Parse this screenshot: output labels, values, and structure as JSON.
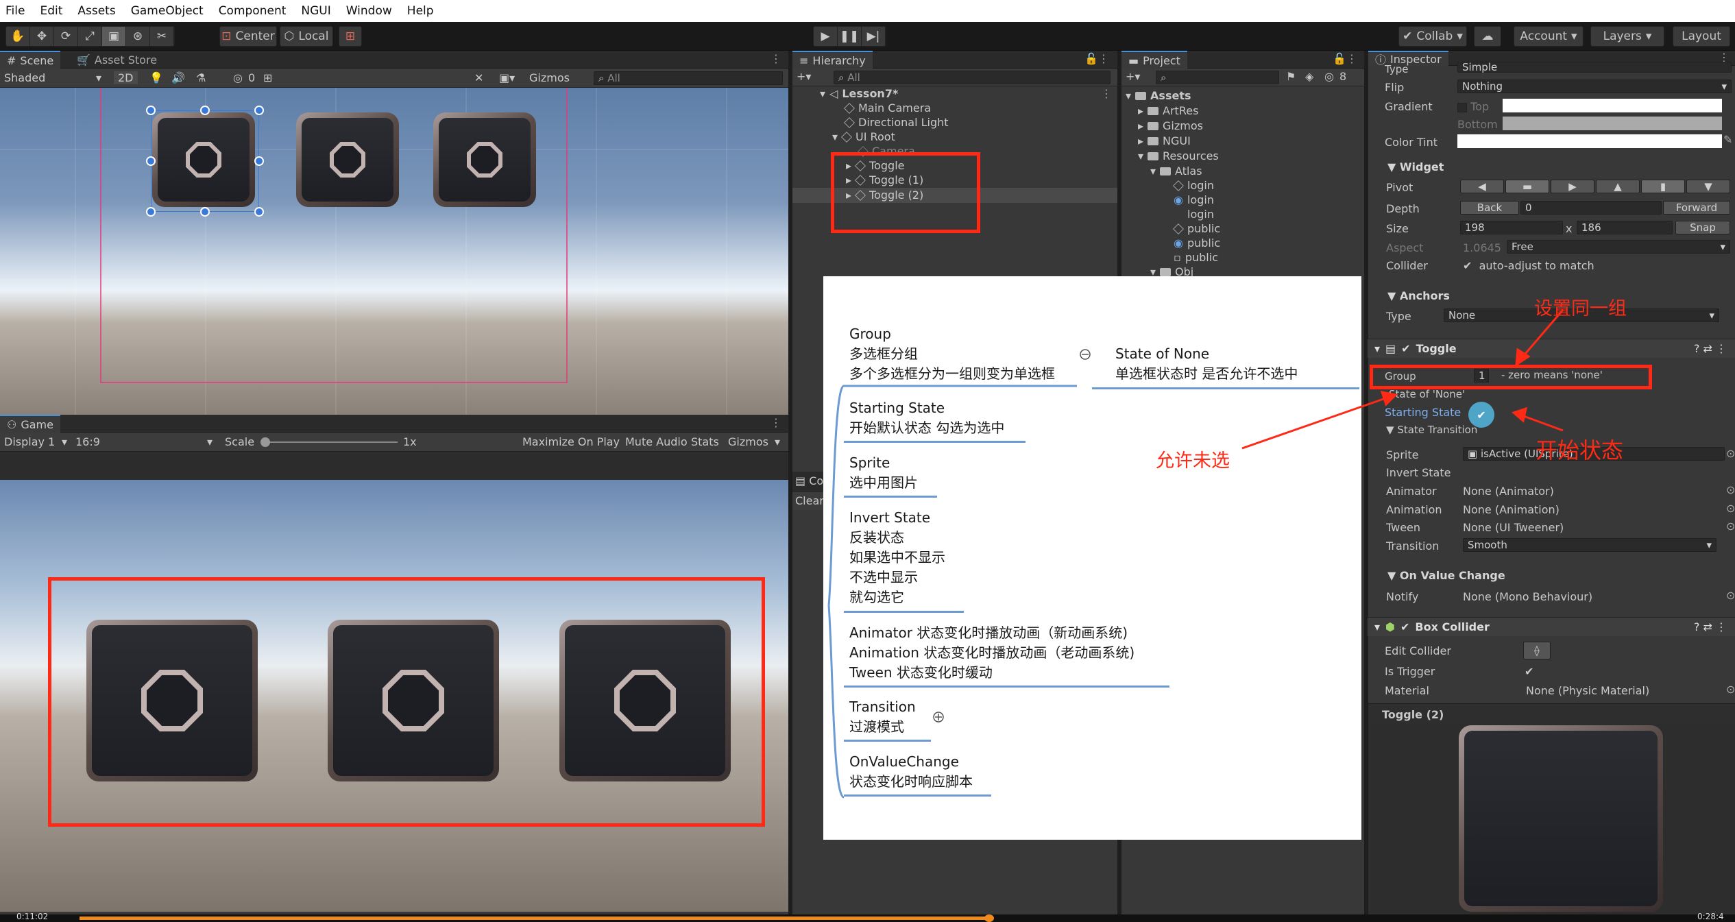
{
  "menu": [
    "File",
    "Edit",
    "Assets",
    "GameObject",
    "Component",
    "NGUI",
    "Window",
    "Help"
  ],
  "toolbar": {
    "center": "Center",
    "local": "Local",
    "collab": "Collab",
    "account": "Account",
    "layers": "Layers",
    "layout": "Layout"
  },
  "scene": {
    "tab": "Scene",
    "tab2": "Asset Store",
    "shading": "Shaded",
    "mode2d": "2D",
    "audio_count": "0",
    "gizmos": "Gizmos",
    "search_placeholder": "All"
  },
  "game": {
    "tab": "Game",
    "display": "Display 1",
    "aspect": "16:9",
    "scale_label": "Scale",
    "scale_value": "1x",
    "maximize": "Maximize On Play",
    "mute": "Mute Audio",
    "stats": "Stats",
    "gizmos": "Gizmos"
  },
  "hierarchy": {
    "tab": "Hierarchy",
    "search_placeholder": "All",
    "scene": "Lesson7*",
    "items": [
      "Main Camera",
      "Directional Light",
      "UI Root",
      "Camera",
      "Toggle",
      "Toggle (1)",
      "Toggle (2)"
    ]
  },
  "project": {
    "tab": "Project",
    "hidden_count": "8",
    "items": [
      "Assets",
      "ArtRes",
      "Gizmos",
      "NGUI",
      "Resources",
      "Atlas",
      "login",
      "login",
      "login",
      "public",
      "public",
      "public",
      "Obj"
    ]
  },
  "console": {
    "tab": "Co",
    "clear": "Clear"
  },
  "inspector": {
    "tab": "Inspector",
    "type_label": "Type",
    "type_value": "Simple",
    "flip_label": "Flip",
    "flip_value": "Nothing",
    "gradient_label": "Gradient",
    "top_label": "Top",
    "bottom_label": "Bottom",
    "tint_label": "Color Tint",
    "widget": "Widget",
    "pivot": "Pivot",
    "depth": "Depth",
    "back": "Back",
    "depth_value": "0",
    "forward": "Forward",
    "size": "Size",
    "size_w": "198",
    "size_x": "x",
    "size_h": "186",
    "snap": "Snap",
    "aspect": "Aspect",
    "aspect_value": "1.0645",
    "aspect_mode": "Free",
    "collider": "Collider",
    "collider_value": "auto-adjust to match",
    "anchors": "Anchors",
    "anchor_type": "Type",
    "anchor_value": "None",
    "toggle": "Toggle",
    "group": "Group",
    "group_value": "1",
    "group_hint": "- zero means 'none'",
    "state_none": "State of 'None'",
    "starting_state": "Starting State",
    "state_transition": "State Transition",
    "sprite": "Sprite",
    "sprite_value": "isActive (UISprite)",
    "invert": "Invert State",
    "animator": "Animator",
    "animator_value": "None (Animator)",
    "animation": "Animation",
    "animation_value": "None (Animation)",
    "tween": "Tween",
    "tween_value": "None (UI Tweener)",
    "transition": "Transition",
    "transition_value": "Smooth",
    "onvalue": "On Value Change",
    "notify": "Notify",
    "notify_value": "None (Mono Behaviour)",
    "box_collider": "Box Collider",
    "edit_collider": "Edit Collider",
    "is_trigger": "Is Trigger",
    "material": "Material",
    "material_value": "None (Physic Material)",
    "preview_title": "Toggle (2)"
  },
  "annotations": {
    "same_group": "设置同一组",
    "start_state": "开始状态",
    "allow_none": "允许未选"
  },
  "mindmap": {
    "group_title": "Group",
    "group_l1": "多选框分组",
    "group_l2": "多个多选框分为一组则变为单选框",
    "none_title": "State of None",
    "none_desc": "单选框状态时 是否允许不选中",
    "start_title": "Starting State",
    "start_desc": "开始默认状态 勾选为选中",
    "sprite_title": "Sprite",
    "sprite_desc": "选中用图片",
    "invert_title": "Invert State",
    "invert_l1": "反装状态",
    "invert_l2": "如果选中不显示",
    "invert_l3": "不选中显示",
    "invert_l4": "就勾选它",
    "anim_l1": "Animator  状态变化时播放动画（新动画系统)",
    "anim_l2": "Animation  状态变化时播放动画（老动画系统)",
    "anim_l3": "Tween  状态变化时缓动",
    "trans_title": "Transition",
    "trans_desc": "过渡模式",
    "onv_title": "OnValueChange",
    "onv_desc": "状态变化时响应脚本"
  },
  "video": {
    "time_left": "0:11:02",
    "time_right": "0:28:4"
  },
  "colors": {
    "annotation_red": "#ff2a16",
    "accent_blue": "#4a8fd4",
    "mindmap_line": "#6b9bd1"
  }
}
